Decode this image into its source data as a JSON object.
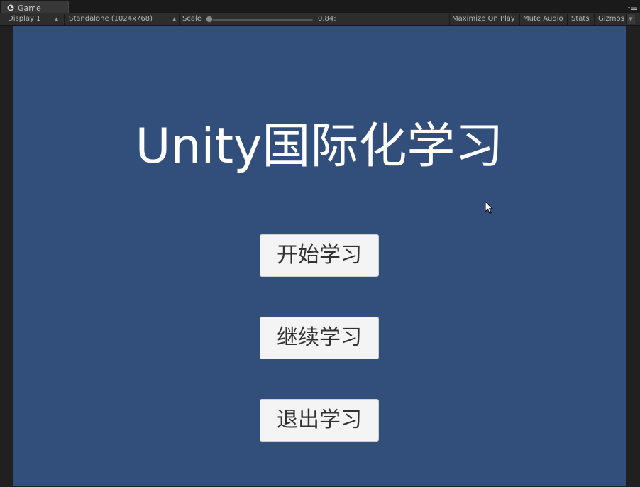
{
  "window": {
    "tab_label": "Game"
  },
  "toolbar": {
    "display": "Display 1",
    "resolution": "Standalone (1024x768)",
    "scale_label": "Scale",
    "scale_value": "0.84:",
    "maximize_on_play": "Maximize On Play",
    "mute_audio": "Mute Audio",
    "stats": "Stats",
    "gizmos": "Gizmos"
  },
  "game": {
    "title": "Unity国际化学习",
    "buttons": [
      {
        "label": "开始学习"
      },
      {
        "label": "继续学习"
      },
      {
        "label": "退出学习"
      }
    ],
    "background_color": "#324f7c",
    "button_color": "#f4f4f4"
  },
  "icons": {
    "tab_icon": "unity-logo-icon",
    "tab_menu": "tab-menu-icon",
    "cursor": "mouse-cursor-icon"
  }
}
